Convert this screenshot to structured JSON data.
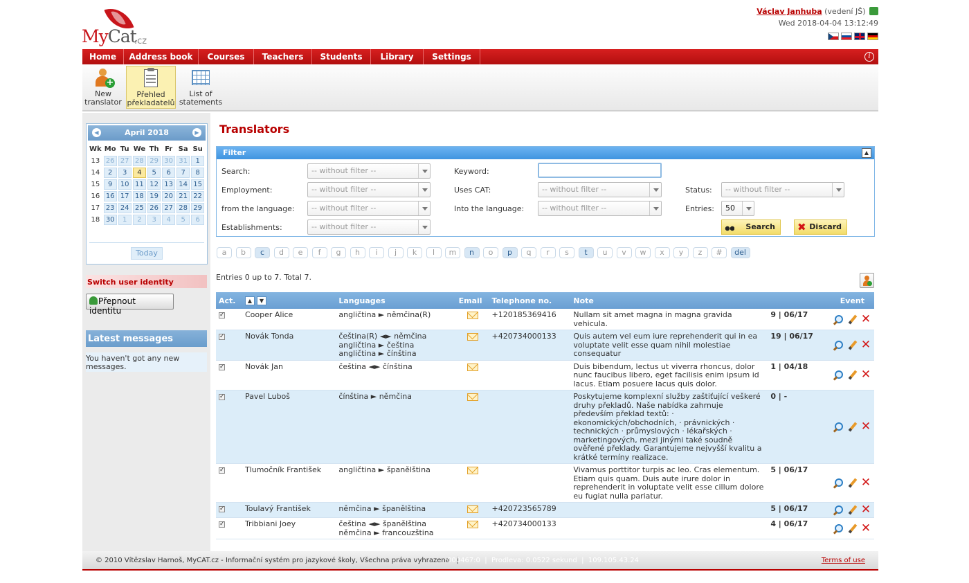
{
  "header": {
    "logo_my": "My",
    "logo_cat": "Cat",
    "logo_domain": ".cz",
    "user_name": "Václav Janhuba",
    "user_role": "(vedení JŠ)",
    "datetime": "Wed 2018-04-04 13:12:49",
    "flags": [
      "cz-flag-icon",
      "sk-flag-icon",
      "gb-flag-icon",
      "de-flag-icon"
    ]
  },
  "nav": {
    "items": [
      "Home",
      "Address book",
      "Courses",
      "Teachers",
      "Students",
      "Library",
      "Settings"
    ],
    "info_symbol": "i"
  },
  "toolbar": {
    "new_translator_1": "New",
    "new_translator_2": "translator",
    "overview_1": "Přehled",
    "overview_2": "překladatelů",
    "statements_1": "List of",
    "statements_2": "statements"
  },
  "calendar": {
    "month": "April 2018",
    "headers": [
      "Wk",
      "Mo",
      "Tu",
      "We",
      "Th",
      "Fr",
      "Sa",
      "Su"
    ],
    "weeks": [
      {
        "wk": "13",
        "days": [
          "26",
          "27",
          "28",
          "29",
          "30",
          "31",
          "1"
        ]
      },
      {
        "wk": "14",
        "days": [
          "2",
          "3",
          "4",
          "5",
          "6",
          "7",
          "8"
        ]
      },
      {
        "wk": "15",
        "days": [
          "9",
          "10",
          "11",
          "12",
          "13",
          "14",
          "15"
        ]
      },
      {
        "wk": "16",
        "days": [
          "16",
          "17",
          "18",
          "19",
          "20",
          "21",
          "22"
        ]
      },
      {
        "wk": "17",
        "days": [
          "23",
          "24",
          "25",
          "26",
          "27",
          "28",
          "29"
        ]
      },
      {
        "wk": "18",
        "days": [
          "30",
          "1",
          "2",
          "3",
          "4",
          "5",
          "6"
        ]
      }
    ],
    "today_label": "Today"
  },
  "sidebar": {
    "switch_title": "Switch user identity",
    "switch_button": "Přepnout identitu",
    "messages_title": "Latest messages",
    "messages_text": "You haven't got any new messages."
  },
  "main": {
    "title": "Translators",
    "filter_title": "Filter",
    "filter": {
      "search_label": "Search:",
      "employment_label": "Employment:",
      "from_lang_label": "from the language:",
      "establishments_label": "Establishments:",
      "keyword_label": "Keyword:",
      "uses_cat_label": "Uses CAT:",
      "into_lang_label": "Into the language:",
      "status_label": "Status:",
      "entries_label": "Entries:",
      "placeholder": "-- without filter --",
      "entries_value": "50",
      "keyword_value": "",
      "search_button": "Search",
      "discard_button": "Discard"
    },
    "letters": [
      "a",
      "b",
      "c",
      "d",
      "e",
      "f",
      "g",
      "h",
      "i",
      "j",
      "k",
      "l",
      "m",
      "n",
      "o",
      "p",
      "q",
      "r",
      "s",
      "t",
      "u",
      "v",
      "w",
      "x",
      "y",
      "z",
      "#"
    ],
    "letters_active": [
      "c",
      "n",
      "p",
      "t"
    ],
    "letter_del": "del",
    "entries_info": "Entries 0 up to 7. Total 7.",
    "columns": {
      "act": "Act.",
      "languages": "Languages",
      "email": "Email",
      "phone": "Telephone no.",
      "note": "Note",
      "event": "Event"
    },
    "rows": [
      {
        "name": "Cooper Alice",
        "languages": [
          "angličtina ► němčina(R)"
        ],
        "phone": "+120185369416",
        "note": "Nullam sit amet magna in magna gravida vehicula.",
        "event_count": "9",
        "event_date": "06/17"
      },
      {
        "name": "Novák Tonda",
        "languages": [
          "čeština(R) ◄► němčina",
          "angličtina ► čeština",
          "angličtina ► čínština"
        ],
        "phone": "+420734000133",
        "note": "Quis autem vel eum iure reprehenderit qui in ea voluptate velit esse quam nihil molestiae consequatur",
        "event_count": "19",
        "event_date": "06/17"
      },
      {
        "name": "Novák Jan",
        "languages": [
          "čeština ◄► čínština"
        ],
        "phone": "",
        "note": "Duis bibendum, lectus ut viverra rhoncus, dolor nunc faucibus libero, eget facilisis enim ipsum id lacus. Etiam posuere lacus quis dolor.",
        "event_count": "1",
        "event_date": "04/18"
      },
      {
        "name": "Pavel Luboš",
        "languages": [
          "čínština ► němčina"
        ],
        "phone": "",
        "note": "Poskytujeme komplexní služby zaštiťující veškeré druhy překladů. Naše nabídka zahrnuje především překlad textů: · ekonomických/obchodních, · právnických · technických · průmyslových · lékařských · marketingových, mezi jinými také soudně ověřené překlady. Garantujeme nejvyšší kvalitu a krátké termíny realizace.",
        "event_count": "0",
        "event_date": "-"
      },
      {
        "name": "Tlumočník František",
        "languages": [
          "angličtina ► španělština"
        ],
        "phone": "",
        "note": "Vivamus porttitor turpis ac leo. Cras elementum. Etiam quis quam. Duis aute irure dolor in reprehenderit in voluptate velit esse cillum dolore eu fugiat nulla pariatur.",
        "event_count": "5",
        "event_date": "06/17"
      },
      {
        "name": "Toulavý František",
        "languages": [
          "němčina ► španělština"
        ],
        "phone": "+420723565789",
        "note": "",
        "event_count": "5",
        "event_date": "06/17"
      },
      {
        "name": "Tribbiani Joey",
        "languages": [
          "čeština ◄► španělština",
          "němčina ► francouzština"
        ],
        "phone": "+420734000133",
        "note": "",
        "event_count": "4",
        "event_date": "06/17"
      }
    ]
  },
  "footer": {
    "copyright": "© 2010 Vítězslav Harnoš, MyCAT.cz - Informační systém pro jazykové školy, Všechna práva vyhrazena   |",
    "stats": "000467:0  |  Prodleva: 0.0522 sekund  |  109.105.43.24",
    "terms": "Terms of use"
  }
}
